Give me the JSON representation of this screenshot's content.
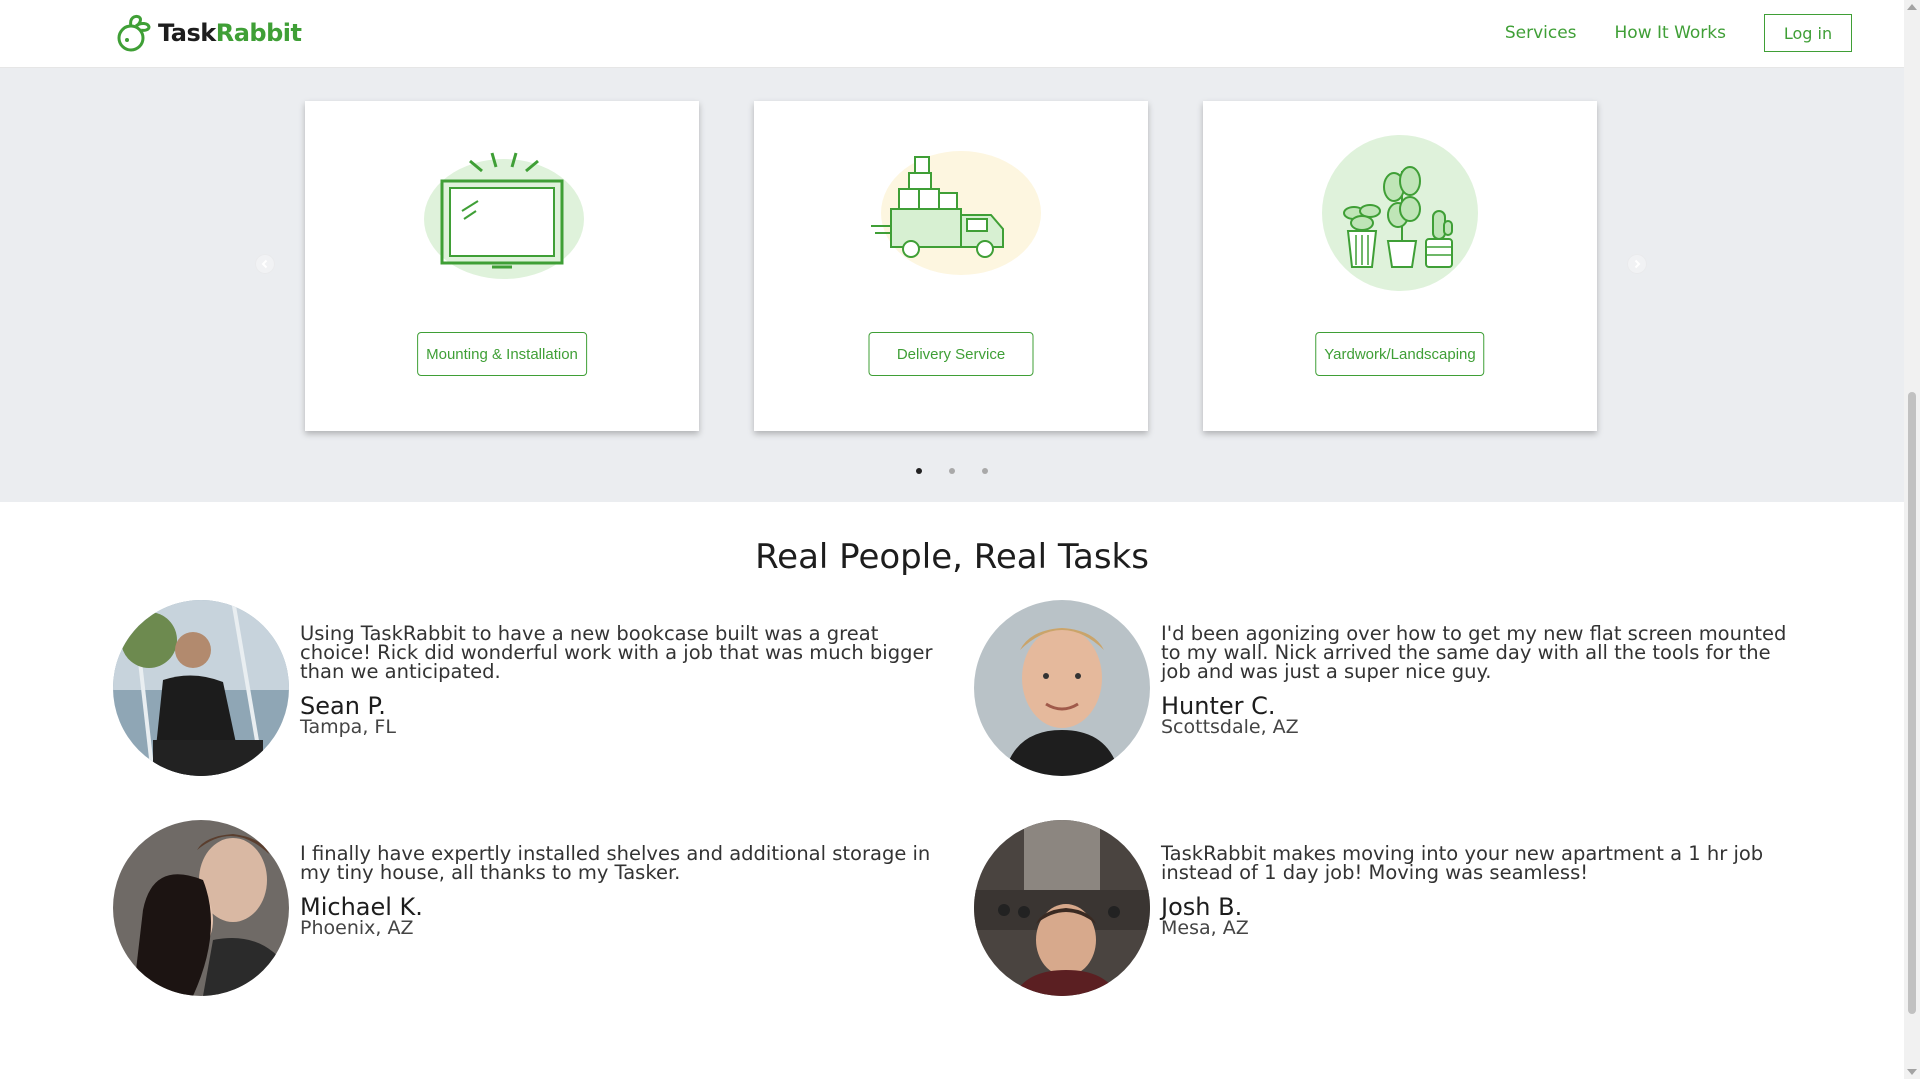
{
  "header": {
    "logo": {
      "word_task": "Task",
      "word_rabbit": "Rabbit",
      "icon": "rabbit-logo-icon"
    },
    "nav": [
      {
        "label": "Services"
      },
      {
        "label": "How It Works"
      }
    ],
    "login_label": "Log in"
  },
  "carousel": {
    "cards": [
      {
        "label": "Mounting & Installation",
        "icon": "tv-mount-icon"
      },
      {
        "label": "Delivery Service",
        "icon": "delivery-truck-icon"
      },
      {
        "label": "Yardwork/Landscaping",
        "icon": "potted-plants-icon"
      }
    ],
    "prev_icon": "chevron-left-icon",
    "next_icon": "chevron-right-icon",
    "page_count": 3,
    "active_page": 1
  },
  "testimonials": {
    "title": "Real People, Real Tasks",
    "items": [
      {
        "quote": "Using TaskRabbit to have a new bookcase built was a great choice! Rick did wonderful work with a job that was much bigger than we anticipated.",
        "name": "Sean P.",
        "location": "Tampa, FL"
      },
      {
        "quote": "I'd been agonizing over how to get my new flat screen mounted to my wall. Nick arrived the same day with all the tools for the job and was just a super nice guy.",
        "name": "Hunter C.",
        "location": "Scottsdale, AZ"
      },
      {
        "quote": "I finally have expertly installed shelves and additional storage in my tiny house, all thanks to my Tasker.",
        "name": "Michael K.",
        "location": "Phoenix, AZ"
      },
      {
        "quote": "TaskRabbit makes moving into your new apartment a 1 hr job instead of 1 day job! Moving was seamless!",
        "name": "Josh B.",
        "location": "Mesa, AZ"
      }
    ]
  },
  "colors": {
    "brand_green": "#3f9f36",
    "band_gray": "#ebedf0",
    "text_dark": "#1d1d1d"
  }
}
